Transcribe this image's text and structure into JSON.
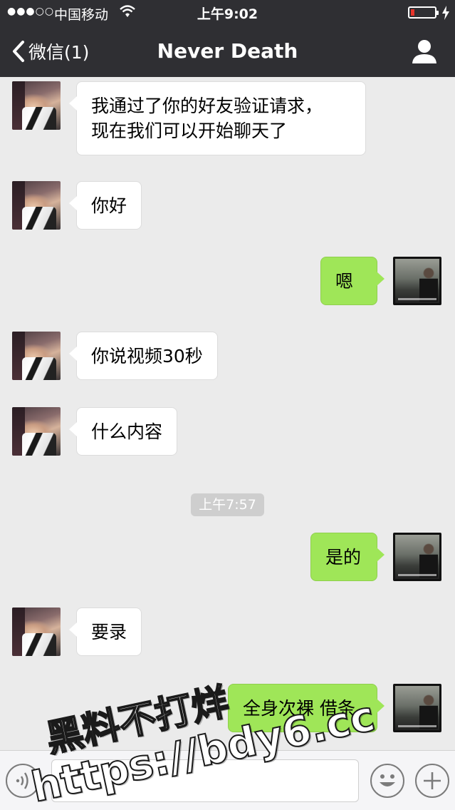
{
  "status_bar": {
    "signal": "●●●○○",
    "carrier": "中国移动",
    "time": "上午9:02",
    "battery_level": 0.15
  },
  "nav": {
    "back_label": "微信(1)",
    "title": "Never Death"
  },
  "messages": [
    {
      "side": "in",
      "lines": [
        "我通过了你的好友验证请求，",
        "现在我们可以开始聊天了"
      ]
    },
    {
      "side": "in",
      "text": "你好"
    },
    {
      "side": "out",
      "text": "嗯"
    },
    {
      "side": "in",
      "text": "你说视频30秒"
    },
    {
      "side": "in",
      "text": "什么内容"
    },
    {
      "side": "out",
      "text": "是的"
    },
    {
      "side": "in",
      "text": "要录"
    },
    {
      "side": "out",
      "text": "全身次裸 借条"
    }
  ],
  "timestamp": "上午7:57",
  "watermark": {
    "line1": "黑料不打烊",
    "line2": "https://bdy6.cc"
  },
  "colors": {
    "nav_bg": "#2f2f33",
    "chat_bg": "#ebebeb",
    "outgoing_bubble": "#9fe658",
    "incoming_bubble": "#ffffff",
    "battery_low": "#e8352b"
  },
  "icons": {
    "back": "chevron-left-icon",
    "profile": "person-icon",
    "voice": "voice-icon",
    "emoji": "smiley-icon",
    "more": "plus-icon"
  }
}
